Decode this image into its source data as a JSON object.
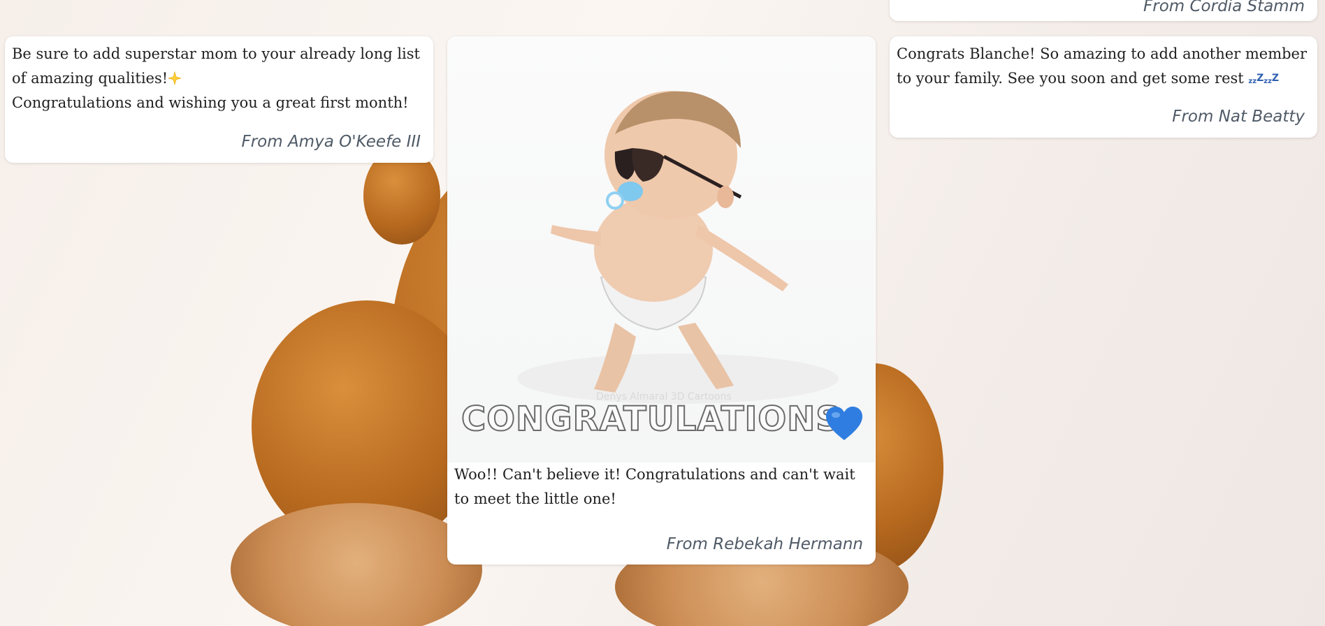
{
  "cards": {
    "top_right_partial": {
      "from": "From Cordia Stamm"
    },
    "amya": {
      "line1": "Be sure to add superstar mom to your already long list of amazing qualities!",
      "line2": "Congratulations and wishing you a great first month!",
      "from": "From Amya O'Keefe III"
    },
    "rebekah": {
      "gif_caption": "CONGRATULATIONS",
      "gif_watermark": "Denys Almaral 3D Cartoons",
      "message": "Woo!! Can't believe it! Congratulations and can't wait to meet the little one!",
      "from": "From Rebekah Hermann"
    },
    "nat": {
      "message": "Congrats Blanche! So amazing to add another member to your family. See you soon and get some rest",
      "zzz": [
        "z",
        "z",
        "Z",
        "z",
        "z",
        "Z"
      ],
      "from": "From Nat Beatty"
    }
  },
  "icons": [
    "sparkle-star-icon",
    "blue-heart-icon",
    "sleeping-zzz-icon"
  ],
  "colors": {
    "from_text": "#4f5a66",
    "heart": "#2f7de0",
    "zzz": "#2f5fb0",
    "card_bg": "#ffffff"
  }
}
